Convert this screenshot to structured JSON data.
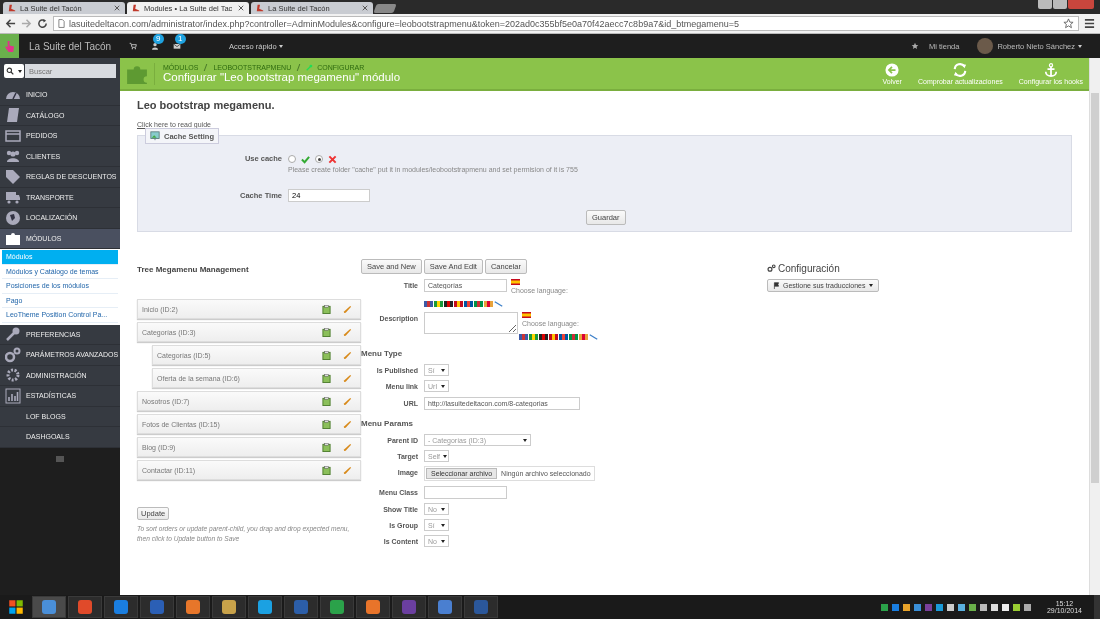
{
  "browser": {
    "tabs": [
      {
        "title": "La Suite del Tacón",
        "selected": false
      },
      {
        "title": "Modules • La Suite del Tac",
        "selected": true
      },
      {
        "title": "La Suite del Tacón",
        "selected": false
      }
    ],
    "url": "lasuitedeltacon.com/administrator/index.php?controller=AdminModules&configure=leobootstrapmenu&token=202ad0c355bf5e0a70f42aecc7c8b9a7&id_btmegamenu=5"
  },
  "topbar": {
    "shop_name": "La Suite del Tacón",
    "customers_badge": "9",
    "messages_badge": "1",
    "quick_access": "Acceso rápido",
    "my_shop": "Mi tienda",
    "user": "Roberto Nieto Sánchez"
  },
  "search": {
    "placeholder": "Buscar"
  },
  "sidebar": {
    "items": [
      {
        "label": "INICIO",
        "selected": false
      },
      {
        "label": "CATÁLOGO",
        "selected": false
      },
      {
        "label": "PEDIDOS",
        "selected": false
      },
      {
        "label": "CLIENTES",
        "selected": false
      },
      {
        "label": "REGLAS DE DESCUENTOS",
        "selected": false
      },
      {
        "label": "TRANSPORTE",
        "selected": false
      },
      {
        "label": "LOCALIZACIÓN",
        "selected": false
      },
      {
        "label": "MÓDULOS",
        "selected": true,
        "expanded": true,
        "children": [
          {
            "label": "Módulos",
            "selected": true
          },
          {
            "label": "Módulos y Catálogo de temas",
            "selected": false
          },
          {
            "label": "Posiciones de los módulos",
            "selected": false
          },
          {
            "label": "Pago",
            "selected": false
          },
          {
            "label": "LeoTheme Position Control Pa...",
            "selected": false
          }
        ]
      },
      {
        "label": "PREFERENCIAS",
        "selected": false
      },
      {
        "label": "PARÁMETROS AVANZADOS",
        "selected": false
      },
      {
        "label": "ADMINISTRACIÓN",
        "selected": false
      },
      {
        "label": "ESTADÍSTICAS",
        "selected": false
      },
      {
        "label": "LOF BLOGS",
        "selected": false
      },
      {
        "label": "DASHGOALS",
        "selected": false
      }
    ]
  },
  "header": {
    "breadcrumb": [
      "MÓDULOS",
      "LEOBOOTSTRAPMENU",
      "CONFIGURAR"
    ],
    "title": "Configurar \"Leo bootstrap megamenu\" módulo",
    "actions": [
      {
        "label": "Volver"
      },
      {
        "label": "Comprobar actualizaciones"
      },
      {
        "label": "Configurar los hooks"
      }
    ]
  },
  "page": {
    "heading": "Leo bootstrap megamenu.",
    "guide_link": "Click here to read guide"
  },
  "cache_panel": {
    "legend": "Cache Setting",
    "use_cache_label": "Use cache",
    "options": [
      {
        "kind": "yes",
        "selected": false
      },
      {
        "kind": "no",
        "selected": true
      }
    ],
    "hint": "Please create folder \"cache\" put it in modules/leobootstrapmenu and set permision of it is 755",
    "cache_time_label": "Cache Time",
    "cache_time": "24",
    "save": "Guardar"
  },
  "tree": {
    "title": "Tree Megamenu Management",
    "items": [
      {
        "label": "Inicio (ID:2)"
      },
      {
        "label": "Categorías (ID:3)",
        "children": [
          {
            "label": "Categorías (ID:5)"
          },
          {
            "label": "Oferta de la semana (ID:6)"
          }
        ]
      },
      {
        "label": "Nosotros (ID:7)"
      },
      {
        "label": "Fotos de Clientas (ID:15)"
      },
      {
        "label": "Blog (ID:9)"
      },
      {
        "label": "Contactar (ID:11)"
      }
    ],
    "update": "Update",
    "note": "To sort orders or update parent-child, you drap and drop expected menu, then click to Update button to Save"
  },
  "form": {
    "buttons": [
      "Save and New",
      "Save And Edit",
      "Cancelar"
    ],
    "rows": [
      {
        "kind": "text",
        "label": "Title",
        "value": "Categorías",
        "lang_hint": "Choose language:"
      },
      {
        "kind": "textarea",
        "label": "Description",
        "value": "",
        "lang_hint": "Choose language:"
      },
      {
        "kind": "section",
        "label": "Menu Type"
      },
      {
        "kind": "select",
        "label": "Is Published",
        "value": "Sí"
      },
      {
        "kind": "select",
        "label": "Menu link",
        "value": "Url"
      },
      {
        "kind": "text",
        "label": "URL",
        "value": "http://lasuitedeltacon.com/8-categorias"
      },
      {
        "kind": "section",
        "label": "Menu Params"
      },
      {
        "kind": "select",
        "label": "Parent ID",
        "value": "- Categorías (ID:3)"
      },
      {
        "kind": "select",
        "label": "Target",
        "value": "Self"
      },
      {
        "kind": "file",
        "label": "Image",
        "button": "Seleccionar archivo",
        "value": "Ningún archivo seleccionado"
      },
      {
        "kind": "text",
        "label": "Menu Class",
        "value": ""
      },
      {
        "kind": "select",
        "label": "Show Title",
        "value": "No"
      },
      {
        "kind": "select",
        "label": "Is Group",
        "value": "Sí"
      },
      {
        "kind": "select",
        "label": "Is Content",
        "value": "No"
      }
    ]
  },
  "config": {
    "title": "Configuración",
    "button": "Gestione sus traducciones"
  },
  "taskbar": {
    "time": "15:12",
    "date": "29/10/2014"
  }
}
